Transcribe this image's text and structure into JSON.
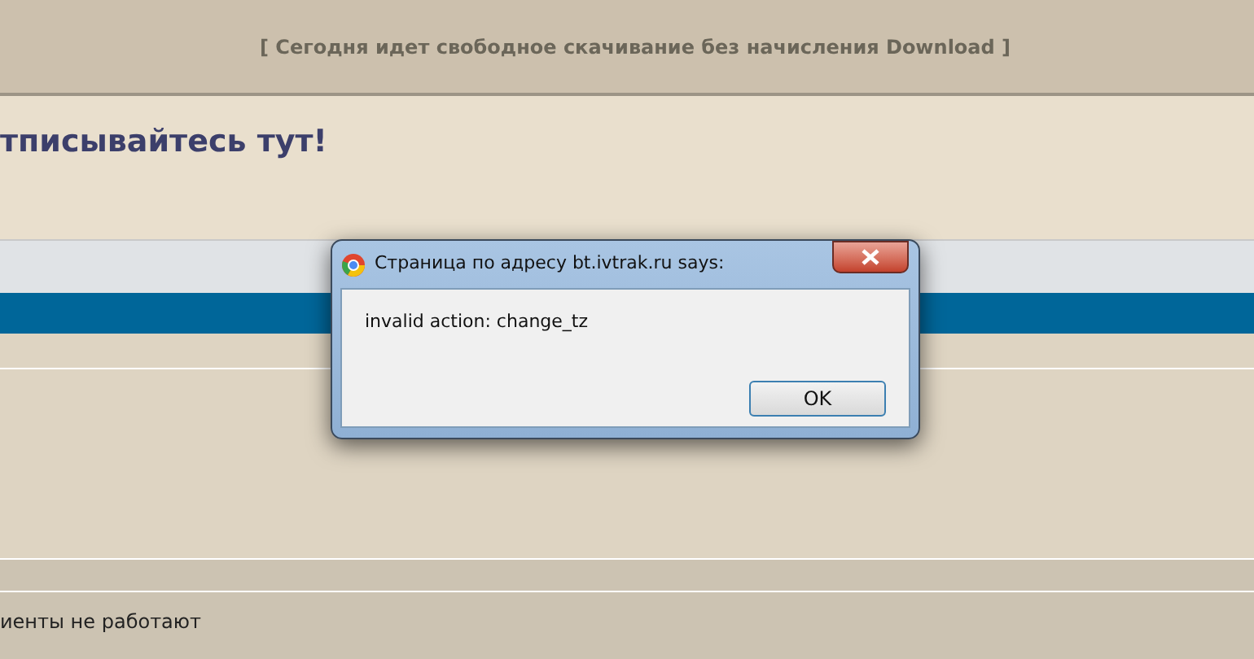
{
  "banner": {
    "text": "[ Сегодня идет свободное скачивание без начисления Download ]"
  },
  "heading": "тписывайтесь тут!",
  "footer_text": "иенты не работают",
  "dialog": {
    "title": "Страница по адресу bt.ivtrak.ru says:",
    "message": "invalid action: change_tz",
    "buttons": [
      "OK"
    ]
  }
}
